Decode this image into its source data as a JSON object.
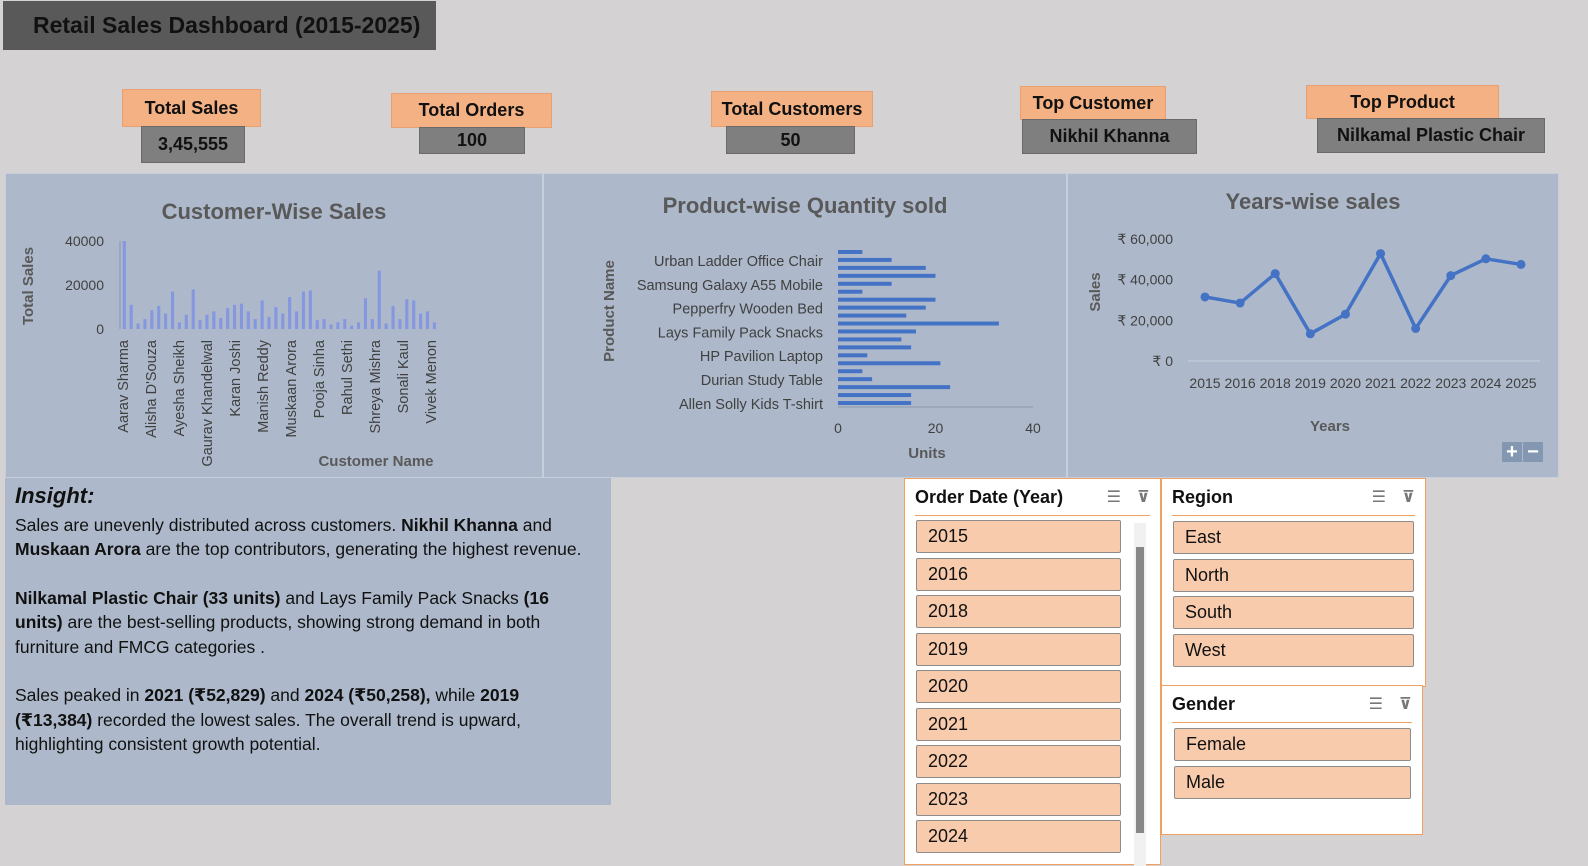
{
  "title": "Retail Sales Dashboard (2015-2025)",
  "kpis": {
    "total_sales": {
      "label": "Total Sales",
      "value": "3,45,555"
    },
    "total_orders": {
      "label": "Total Orders",
      "value": "100"
    },
    "total_customers": {
      "label": "Total Customers",
      "value": "50"
    },
    "top_customer": {
      "label": "Top Customer",
      "value": "Nikhil Khanna"
    },
    "top_product": {
      "label": "Top Product",
      "value": "Nilkamal Plastic Chair"
    }
  },
  "chart_data": [
    {
      "type": "bar",
      "title": "Customer-Wise Sales",
      "xlabel": "Customer Name",
      "ylabel": "Total Sales",
      "ylim": [
        0,
        40000
      ],
      "yticks": [
        "40000",
        "20000",
        "0"
      ],
      "tick_labels": [
        "Aarav Sharma",
        "Alisha D'Souza",
        "Ayesha Sheikh",
        "Gaurav Khandelwal",
        "Karan Joshi",
        "Manish Reddy",
        "Muskaan Arora",
        "Pooja Sinha",
        "Rahul Sethi",
        "Shreya Mishra",
        "Sonali Kaul",
        "Vivek Menon"
      ],
      "values": [
        40000,
        11000,
        2500,
        4500,
        8500,
        10500,
        7000,
        17000,
        3000,
        6500,
        18000,
        4000,
        6500,
        8000,
        5000,
        9500,
        11000,
        11500,
        8000,
        4500,
        13000,
        5500,
        10000,
        7000,
        14500,
        8000,
        17000,
        17500,
        4000,
        4500,
        2000,
        3000,
        4500,
        1500,
        3000,
        14000,
        4500,
        26500,
        2500,
        10500,
        4500,
        13500,
        13000,
        7000,
        8000,
        3000
      ],
      "color": "#8497e0"
    },
    {
      "type": "bar",
      "orientation": "horizontal",
      "title": "Product-wise Quantity sold",
      "xlabel": "Units",
      "ylabel": "Product Name",
      "xlim": [
        0,
        40
      ],
      "xticks": [
        "0",
        "20",
        "40"
      ],
      "tick_labels": [
        "Urban Ladder Office Chair",
        "Samsung Galaxy A55 Mobile",
        "Pepperfry Wooden Bed",
        "Lays Family Pack Snacks",
        "HP Pavilion Laptop",
        "Durian Study Table",
        "Allen Solly Kids T-shirt"
      ],
      "values": [
        5,
        11,
        18,
        20,
        11,
        5,
        20,
        18,
        14,
        33,
        16,
        13,
        15,
        6,
        21,
        5,
        7,
        23,
        15,
        15
      ],
      "color": "#4472c4"
    },
    {
      "type": "line",
      "title": "Years-wise sales",
      "xlabel": "Years",
      "ylabel": "Sales",
      "ylim": [
        0,
        60000
      ],
      "yticks": [
        "₹ 60,000",
        "₹ 40,000",
        "₹ 20,000",
        "₹ 0"
      ],
      "categories": [
        "2015",
        "2016",
        "2018",
        "2019",
        "2020",
        "2021",
        "2022",
        "2023",
        "2024",
        "2025"
      ],
      "values": [
        31500,
        28500,
        43000,
        13384,
        23000,
        52829,
        16000,
        42000,
        50258,
        47500
      ],
      "color": "#4472c4"
    }
  ],
  "insight": {
    "heading": "Insight:",
    "p1": [
      " Sales are unevenly distributed across customers. ",
      "Nikhil Khanna",
      " and ",
      "Muskaan Arora",
      " are the top contributors, generating the highest revenue."
    ],
    "p2": [
      " Nilkamal Plastic Chair (33 units)",
      " and Lays Family Pack Snacks ",
      "(16 units)",
      " are the best-selling products, showing strong demand in both furniture and FMCG categories ."
    ],
    "p3": [
      "Sales peaked in ",
      "2021 (₹52,829)",
      " and ",
      "2024 (₹50,258),",
      " while ",
      "2019 (₹13,384)",
      " recorded the lowest sales. The overall trend is upward, highlighting consistent growth potential."
    ]
  },
  "slicers": {
    "year": {
      "title": "Order Date (Year)",
      "items": [
        "2015",
        "2016",
        "2018",
        "2019",
        "2020",
        "2021",
        "2022",
        "2023",
        "2024"
      ]
    },
    "region": {
      "title": "Region",
      "items": [
        "East",
        "North",
        "South",
        "West"
      ]
    },
    "gender": {
      "title": "Gender",
      "items": [
        "Female",
        "Male"
      ]
    }
  },
  "icons": {
    "multi_select": "multi-select-icon",
    "clear_filter": "clear-filter-icon"
  },
  "chart_controls": {
    "zoom_in": "+",
    "zoom_out": "−"
  }
}
